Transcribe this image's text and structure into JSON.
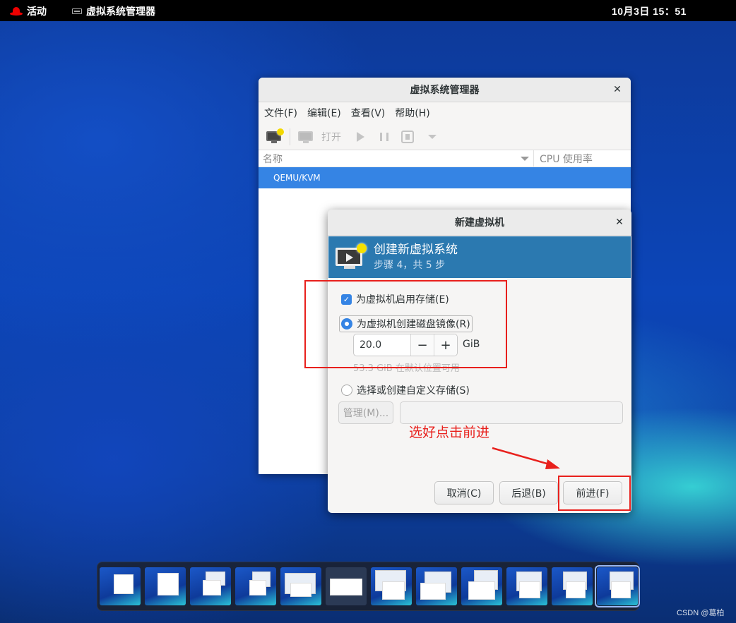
{
  "topbar": {
    "activities_label": "活动",
    "app_name": "虚拟系统管理器",
    "clock": "10月3日 15：51"
  },
  "main_window": {
    "title": "虚拟系统管理器",
    "menu": [
      "文件(F)",
      "编辑(E)",
      "查看(V)",
      "帮助(H)"
    ],
    "toolbar": {
      "new_vm_icon": "new-vm-icon",
      "open_label": "打开"
    },
    "columns": {
      "name": "名称",
      "cpu": "CPU 使用率"
    },
    "connections": [
      "QEMU/KVM"
    ]
  },
  "dialog": {
    "title": "新建虚拟机",
    "banner_title": "创建新虚拟系统",
    "banner_step": "步骤 4，共 5 步",
    "enable_storage_label": "为虚拟机启用存储(E)",
    "enable_storage_checked": true,
    "create_disk_label": "为虚拟机创建磁盘镜像(R)",
    "create_disk_selected": true,
    "disk_size": "20.0",
    "disk_unit": "GiB",
    "available_text": "53.3 GiB 在默认位置可用",
    "custom_storage_label": "选择或创建自定义存储(S)",
    "custom_storage_selected": false,
    "manage_button": "管理(M)...",
    "custom_path_value": "",
    "cancel_button": "取消(C)",
    "back_button": "后退(B)",
    "forward_button": "前进(F)"
  },
  "annotation": {
    "text": "选好点击前进",
    "color": "#e8201c"
  },
  "dock": {
    "window_count": 12,
    "active_index": 11
  },
  "watermark": "CSDN @葛柏",
  "colors": {
    "accent": "#3584e4",
    "banner": "#2b79b0",
    "annotation_red": "#e8201c"
  }
}
